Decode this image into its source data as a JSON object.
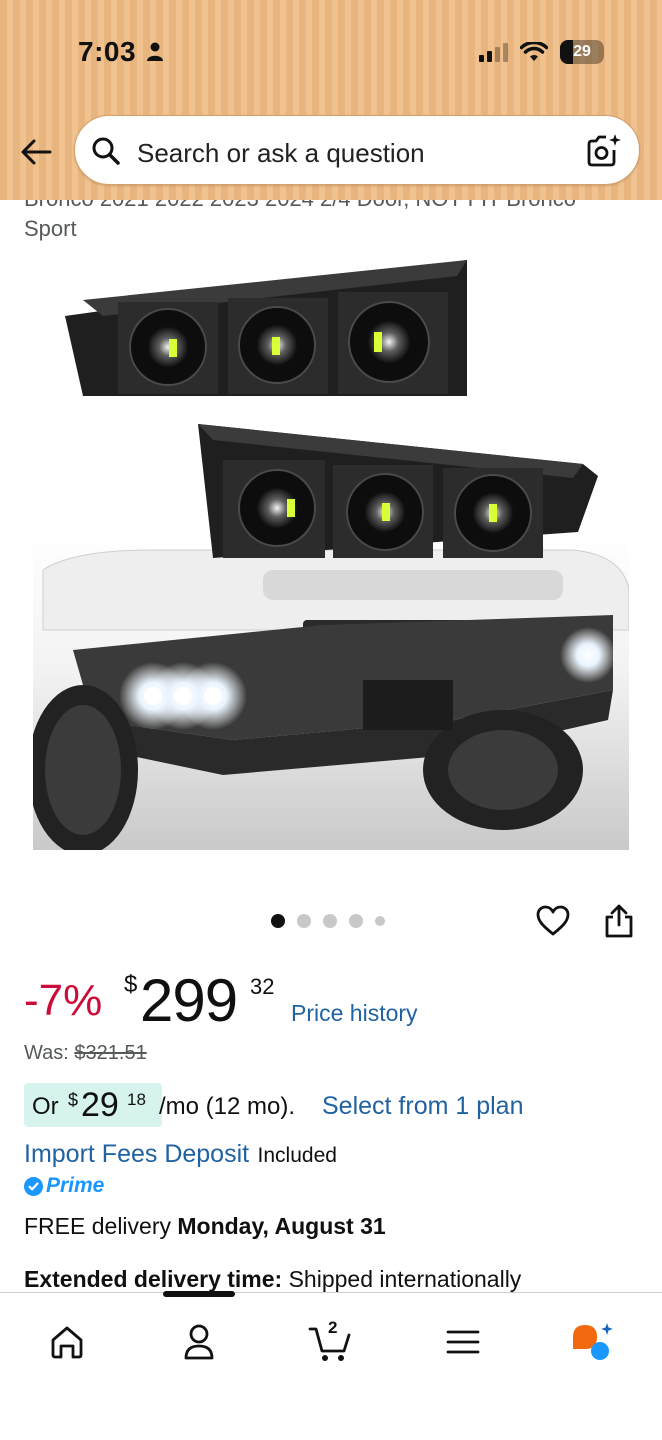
{
  "status_bar": {
    "time": "7:03",
    "battery": "29"
  },
  "header": {
    "search_placeholder": "Search or ask a question"
  },
  "product": {
    "title_partial_line1": "Bronco 2021 2022 2023 2024 2/4 Door, NOT FIT Bronco",
    "title_partial_line2": "Sport"
  },
  "carousel": {
    "total_images": 5,
    "active_index": 0
  },
  "price": {
    "discount": "-7%",
    "currency": "$",
    "whole": "299",
    "fraction": "32",
    "history_link": "Price history",
    "was_label": "Was:",
    "was_value": "$321.51"
  },
  "installment": {
    "or_label": "Or",
    "currency": "$",
    "whole": "29",
    "fraction": "18",
    "term": "/mo (12 mo).",
    "link": "Select from 1 plan"
  },
  "import_fees": {
    "link": "Import Fees Deposit",
    "status": "Included"
  },
  "prime": {
    "label": "Prime"
  },
  "delivery": {
    "prefix": "FREE delivery",
    "date": "Monday, August 31"
  },
  "extended": {
    "label": "Extended delivery time:",
    "text": "Shipped internationally"
  },
  "bottom_nav": {
    "items": [
      "home",
      "account",
      "cart",
      "menu",
      "rufus"
    ],
    "cart_count": "2",
    "active": "account"
  },
  "colors": {
    "header_bg": "#efc28f",
    "discount_red": "#cc0c39",
    "link_blue": "#2162a1",
    "prime_blue": "#1a98ff",
    "installment_bg": "#d6f3ed",
    "rufus_orange": "#f2690f"
  }
}
